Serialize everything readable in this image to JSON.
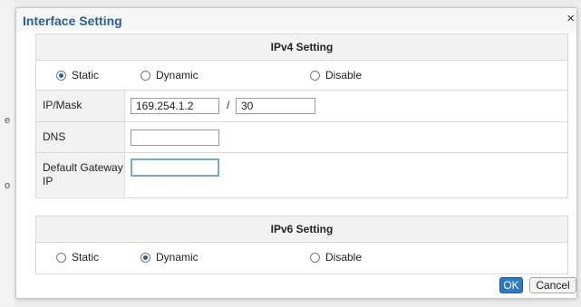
{
  "dialog": {
    "title": "Interface Setting",
    "close_icon": "×"
  },
  "ipv4": {
    "heading": "IPv4 Setting",
    "options": [
      {
        "label": "Static",
        "checked": true
      },
      {
        "label": "Dynamic",
        "checked": false
      },
      {
        "label": "Disable",
        "checked": false
      }
    ],
    "ip_mask_label": "IP/Mask",
    "ip_value": "169.254.1.2",
    "separator": "/",
    "mask_value": "30",
    "dns_label": "DNS",
    "dns_value": "",
    "gateway_label": "Default Gateway IP",
    "gateway_value": ""
  },
  "ipv6": {
    "heading": "IPv6 Setting",
    "options": [
      {
        "label": "Static",
        "checked": false
      },
      {
        "label": "Dynamic",
        "checked": true
      },
      {
        "label": "Disable",
        "checked": false
      }
    ]
  },
  "buttons": {
    "ok": "OK",
    "cancel": "Cancel"
  },
  "background_fragments": [
    "e",
    "o"
  ]
}
